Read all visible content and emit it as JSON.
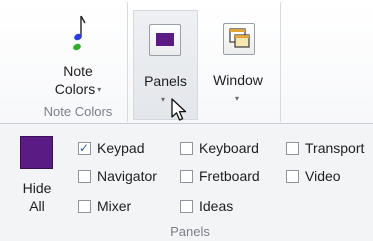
{
  "ribbon": {
    "note_colors": {
      "label_line1": "Note",
      "label_line2": "Colors",
      "group_label": "Note Colors"
    },
    "panels": {
      "label": "Panels"
    },
    "window": {
      "label": "Window"
    },
    "dropdown_marker": "▾"
  },
  "panels_menu": {
    "hide_all": {
      "line1": "Hide",
      "line2": "All",
      "swatch_color": "#5a1c84"
    },
    "items": [
      {
        "label": "Keypad",
        "checked": true
      },
      {
        "label": "Keyboard",
        "checked": false
      },
      {
        "label": "Transport",
        "checked": false
      },
      {
        "label": "Navigator",
        "checked": false
      },
      {
        "label": "Fretboard",
        "checked": false
      },
      {
        "label": "Video",
        "checked": false
      },
      {
        "label": "Mixer",
        "checked": false
      },
      {
        "label": "Ideas",
        "checked": false
      }
    ],
    "group_label": "Panels",
    "check_mark": "✓"
  }
}
